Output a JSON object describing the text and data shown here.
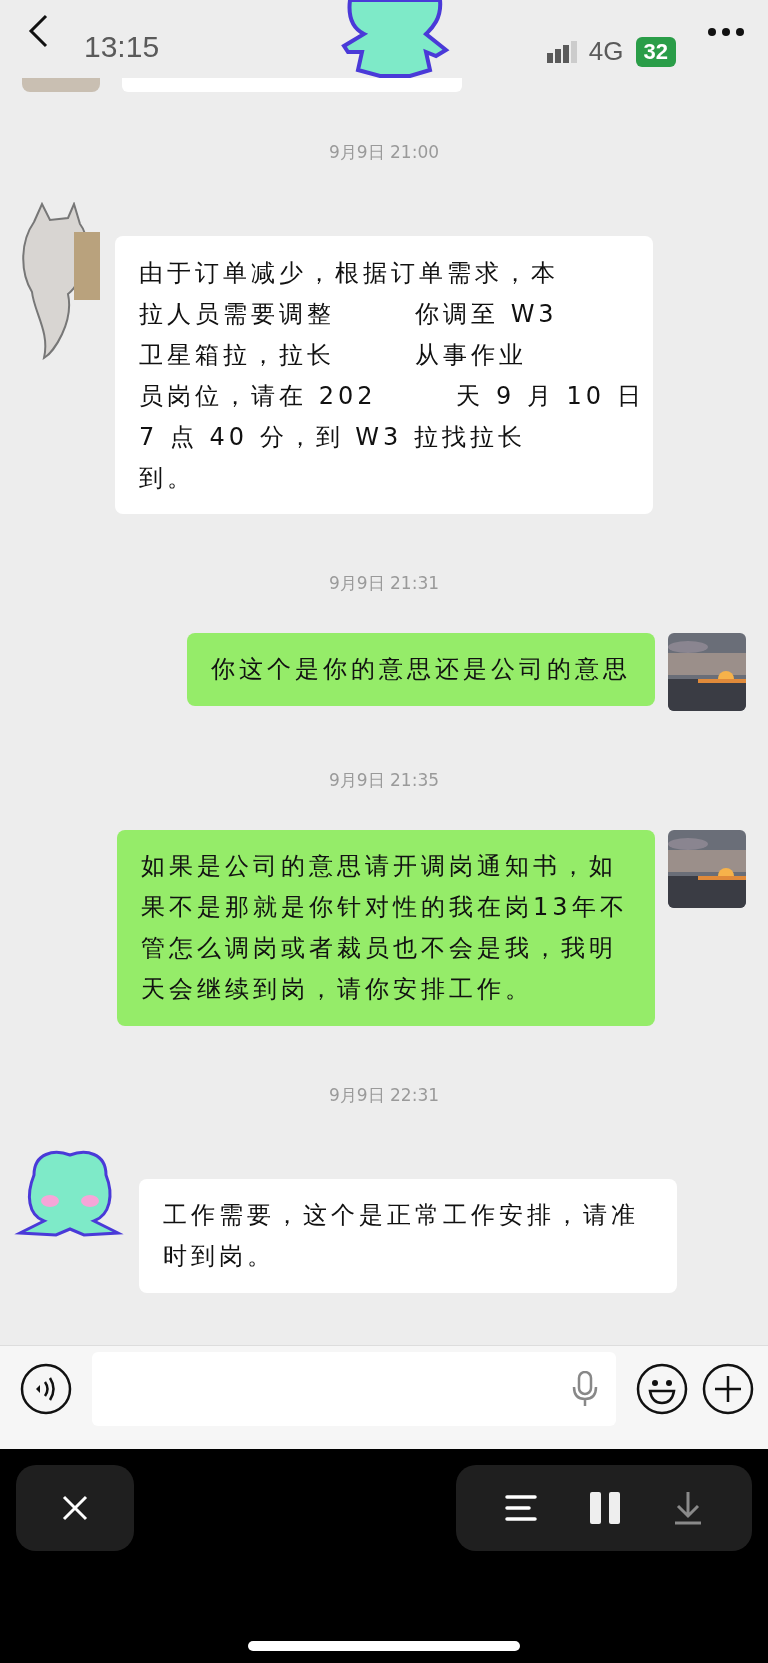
{
  "status_bar": {
    "time": "13:15",
    "network": "4G",
    "battery": "32"
  },
  "messages": [
    {
      "kind": "time",
      "text": "9月9日 21:00"
    },
    {
      "kind": "received",
      "lines": [
        [
          {
            "kind": "text",
            "text": "由于订单减少，根据订单需求，本"
          }
        ],
        [
          {
            "kind": "text",
            "text": "拉人员需要调整"
          },
          {
            "kind": "text",
            "text": "你调至 W3"
          }
        ],
        [
          {
            "kind": "text",
            "text": "卫星箱拉，拉长"
          },
          {
            "kind": "text",
            "text": "从事作业"
          }
        ],
        [
          {
            "kind": "text",
            "text": "员岗位，请在 202"
          },
          {
            "kind": "text",
            "text": "天 9 月 10 日"
          }
        ],
        [
          {
            "kind": "text",
            "text": "7 点 40 分，到 W3 拉找拉长"
          }
        ],
        [
          {
            "kind": "text",
            "text": "到。"
          }
        ]
      ]
    },
    {
      "kind": "time",
      "text": "9月9日 21:31"
    },
    {
      "kind": "sent",
      "text": "你这个是你的意思还是公司的意思"
    },
    {
      "kind": "time",
      "text": "9月9日 21:35"
    },
    {
      "kind": "sent",
      "text": "如果是公司的意思请开调岗通知书，如果不是那就是你针对性的我在岗13年不管怎么调岗或者裁员也不会是我，我明天会继续到岗，请你安排工作。"
    },
    {
      "kind": "time",
      "text": "9月9日 22:31"
    },
    {
      "kind": "received",
      "text": "工作需要，这个是正常工作安排，请准时到岗。"
    }
  ]
}
